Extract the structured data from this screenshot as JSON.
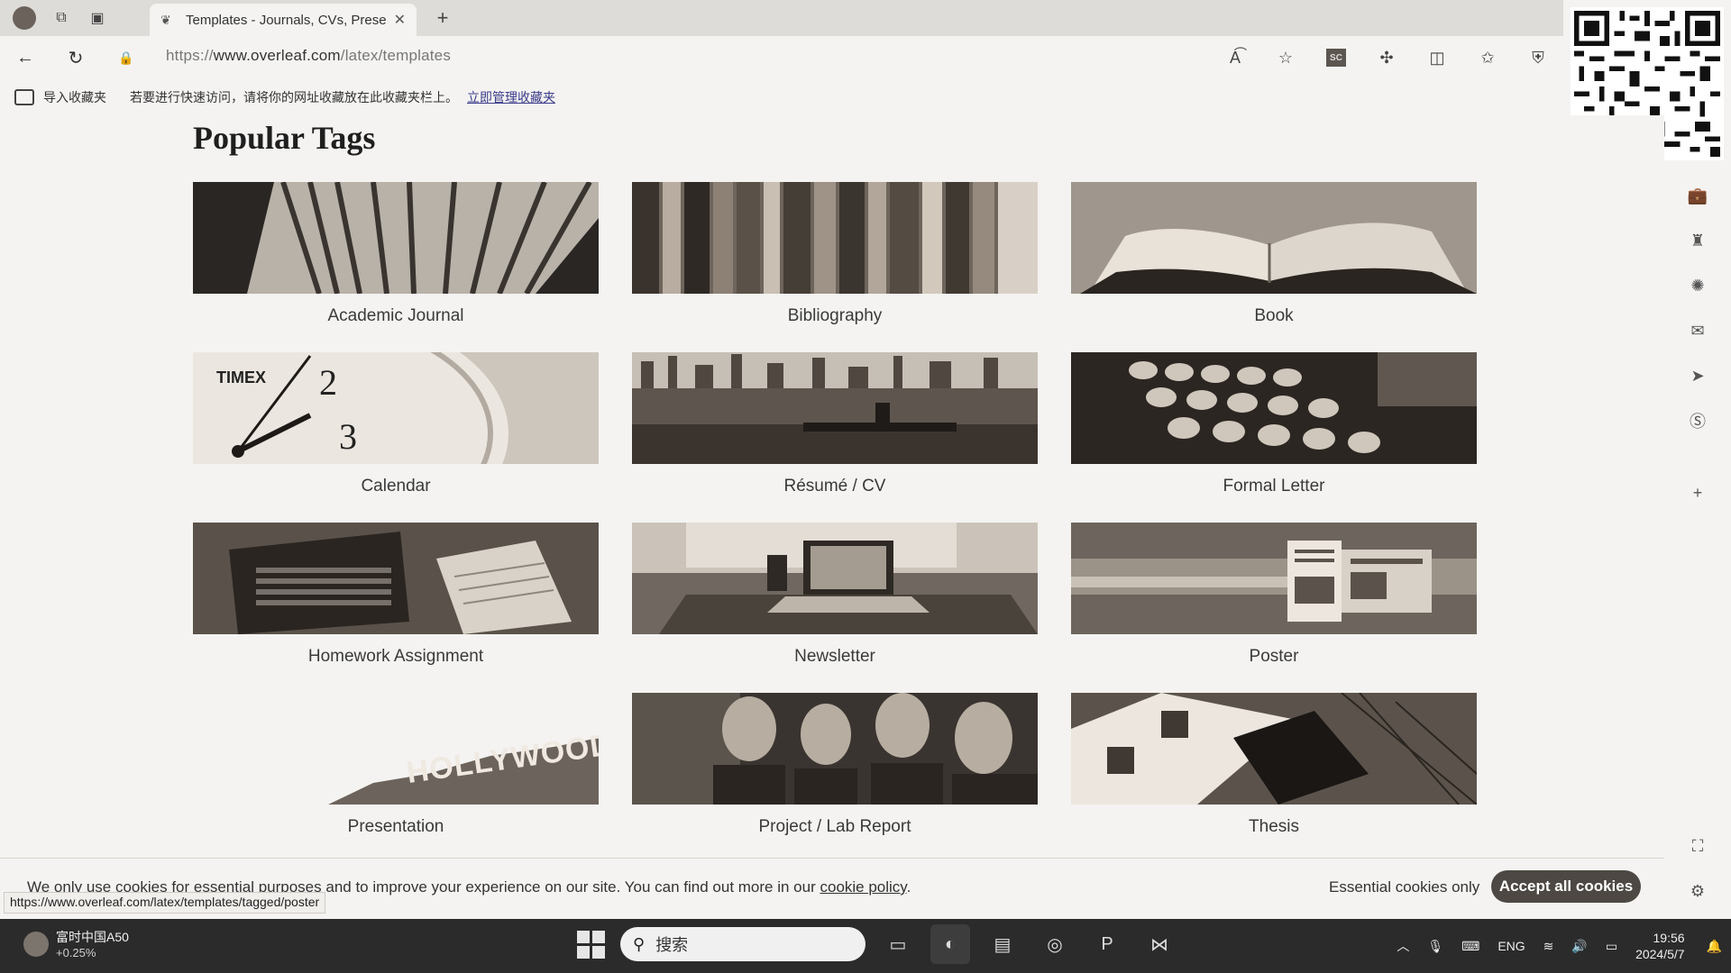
{
  "browser": {
    "tab_title": "Templates - Journals, CVs, Presen",
    "url_prefix": "https://",
    "url_main": "www.overleaf.com",
    "url_path": "/latex/templates",
    "favorites_import": "导入收藏夹",
    "favorites_message": "若要进行快速访问，请将你的网址收藏放在此收藏夹栏上。",
    "favorites_manage": "立即管理收藏夹",
    "sc_label": "SC"
  },
  "page": {
    "heading": "Popular Tags",
    "tags": [
      {
        "label": "Academic Journal"
      },
      {
        "label": "Bibliography"
      },
      {
        "label": "Book"
      },
      {
        "label": "Calendar"
      },
      {
        "label": "Résumé / CV"
      },
      {
        "label": "Formal Letter"
      },
      {
        "label": "Homework Assignment"
      },
      {
        "label": "Newsletter"
      },
      {
        "label": "Poster"
      },
      {
        "label": "Presentation"
      },
      {
        "label": "Project / Lab Report"
      },
      {
        "label": "Thesis"
      }
    ],
    "image_text": {
      "timex": "TIMEX",
      "clock_2": "2",
      "clock_3": "3",
      "hollywood": "HOLLYWOOD"
    }
  },
  "cookie": {
    "text": "We only use cookies for essential purposes and to improve your experience on our site. You can find out more in our",
    "link": "cookie policy",
    "essential": "Essential cookies only",
    "accept": "Accept all cookies"
  },
  "status_url": "https://www.overleaf.com/latex/templates/tagged/poster",
  "taskbar": {
    "stock_name": "富时中国A50",
    "stock_change": "+0.25%",
    "search_placeholder": "搜索",
    "language": "ENG",
    "time": "19:56",
    "date": "2024/5/7"
  }
}
